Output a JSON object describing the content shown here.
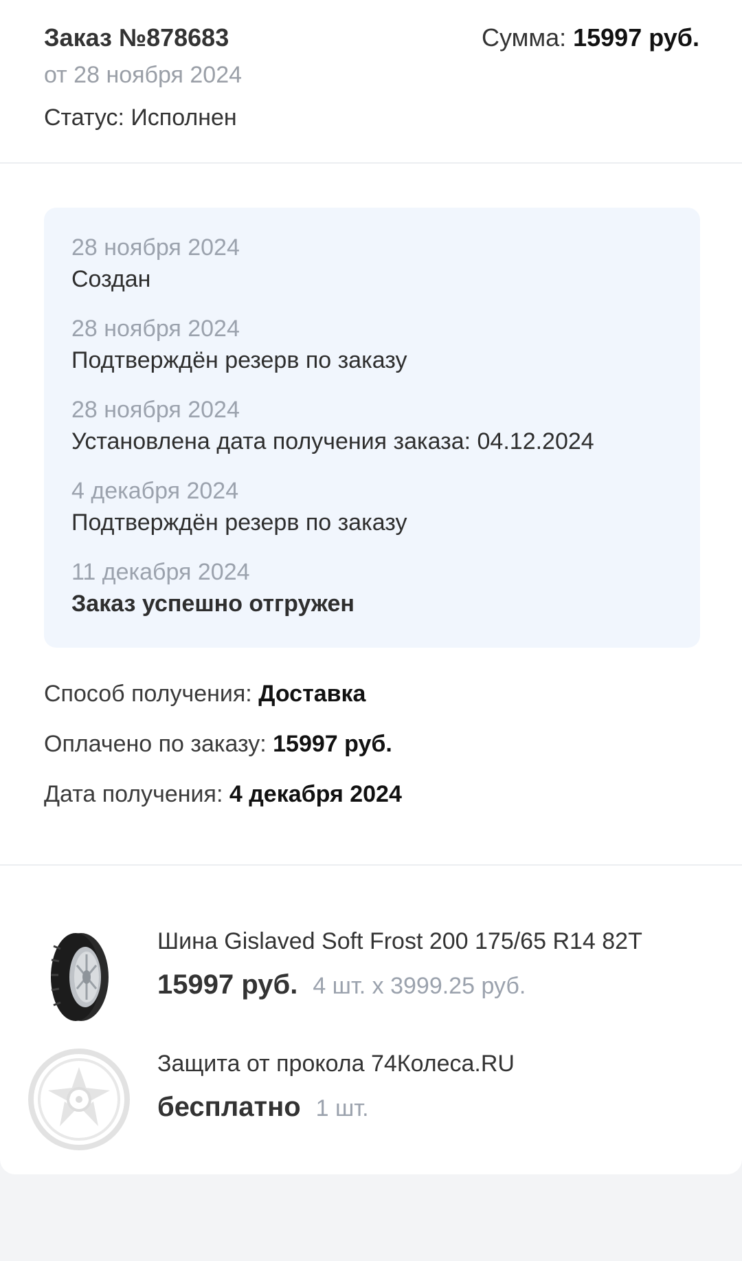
{
  "order": {
    "number": "Заказ №878683",
    "sum_label": "Сумма: ",
    "sum_value": "15997 руб.",
    "date": "от 28 ноября 2024",
    "status": "Статус: Исполнен"
  },
  "history": [
    {
      "date": "28 ноября 2024",
      "text": "Создан"
    },
    {
      "date": "28 ноября 2024",
      "text": "Подтверждён резерв по заказу"
    },
    {
      "date": "28 ноября 2024",
      "text": "Установлена дата получения заказа: 04.12.2024"
    },
    {
      "date": "4 декабря 2024",
      "text": "Подтверждён резерв по заказу"
    },
    {
      "date": "11 декабря 2024",
      "text": "Заказ успешно отгружен"
    }
  ],
  "info": {
    "delivery_label": "Способ получения: ",
    "delivery_value": "Доставка",
    "paid_label": "Оплачено по заказу: ",
    "paid_value": "15997 руб.",
    "receive_label": "Дата получения: ",
    "receive_value": "4 декабря 2024"
  },
  "products": [
    {
      "name": "Шина Gislaved Soft Frost 200 175/65 R14 82T",
      "price": "15997 руб.",
      "qty": "4 шт. x 3999.25 руб.",
      "icon": "tire-icon"
    },
    {
      "name": "Защита от прокола 74Колеса.RU",
      "price": "бесплатно",
      "qty": "1 шт.",
      "icon": "wheel-rim-icon"
    }
  ],
  "colors": {
    "history_bg": "#f1f6fd",
    "muted_text": "#9ba2ad",
    "page_bg": "#f3f4f6"
  }
}
